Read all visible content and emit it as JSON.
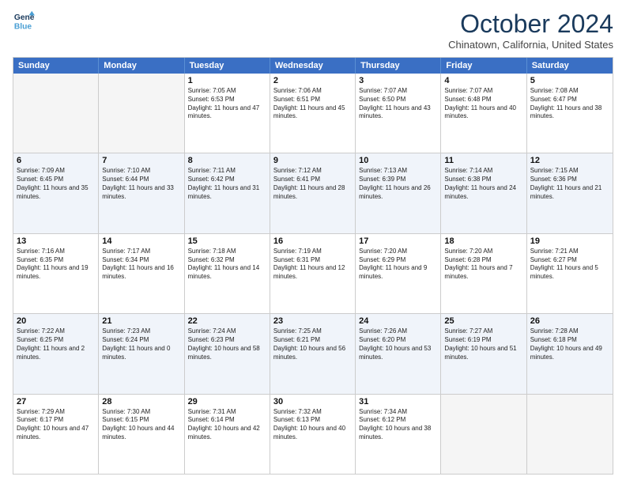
{
  "header": {
    "logo_line1": "General",
    "logo_line2": "Blue",
    "month": "October 2024",
    "location": "Chinatown, California, United States"
  },
  "days_of_week": [
    "Sunday",
    "Monday",
    "Tuesday",
    "Wednesday",
    "Thursday",
    "Friday",
    "Saturday"
  ],
  "weeks": [
    [
      {
        "day": "",
        "text": ""
      },
      {
        "day": "",
        "text": ""
      },
      {
        "day": "1",
        "text": "Sunrise: 7:05 AM\nSunset: 6:53 PM\nDaylight: 11 hours and 47 minutes."
      },
      {
        "day": "2",
        "text": "Sunrise: 7:06 AM\nSunset: 6:51 PM\nDaylight: 11 hours and 45 minutes."
      },
      {
        "day": "3",
        "text": "Sunrise: 7:07 AM\nSunset: 6:50 PM\nDaylight: 11 hours and 43 minutes."
      },
      {
        "day": "4",
        "text": "Sunrise: 7:07 AM\nSunset: 6:48 PM\nDaylight: 11 hours and 40 minutes."
      },
      {
        "day": "5",
        "text": "Sunrise: 7:08 AM\nSunset: 6:47 PM\nDaylight: 11 hours and 38 minutes."
      }
    ],
    [
      {
        "day": "6",
        "text": "Sunrise: 7:09 AM\nSunset: 6:45 PM\nDaylight: 11 hours and 35 minutes."
      },
      {
        "day": "7",
        "text": "Sunrise: 7:10 AM\nSunset: 6:44 PM\nDaylight: 11 hours and 33 minutes."
      },
      {
        "day": "8",
        "text": "Sunrise: 7:11 AM\nSunset: 6:42 PM\nDaylight: 11 hours and 31 minutes."
      },
      {
        "day": "9",
        "text": "Sunrise: 7:12 AM\nSunset: 6:41 PM\nDaylight: 11 hours and 28 minutes."
      },
      {
        "day": "10",
        "text": "Sunrise: 7:13 AM\nSunset: 6:39 PM\nDaylight: 11 hours and 26 minutes."
      },
      {
        "day": "11",
        "text": "Sunrise: 7:14 AM\nSunset: 6:38 PM\nDaylight: 11 hours and 24 minutes."
      },
      {
        "day": "12",
        "text": "Sunrise: 7:15 AM\nSunset: 6:36 PM\nDaylight: 11 hours and 21 minutes."
      }
    ],
    [
      {
        "day": "13",
        "text": "Sunrise: 7:16 AM\nSunset: 6:35 PM\nDaylight: 11 hours and 19 minutes."
      },
      {
        "day": "14",
        "text": "Sunrise: 7:17 AM\nSunset: 6:34 PM\nDaylight: 11 hours and 16 minutes."
      },
      {
        "day": "15",
        "text": "Sunrise: 7:18 AM\nSunset: 6:32 PM\nDaylight: 11 hours and 14 minutes."
      },
      {
        "day": "16",
        "text": "Sunrise: 7:19 AM\nSunset: 6:31 PM\nDaylight: 11 hours and 12 minutes."
      },
      {
        "day": "17",
        "text": "Sunrise: 7:20 AM\nSunset: 6:29 PM\nDaylight: 11 hours and 9 minutes."
      },
      {
        "day": "18",
        "text": "Sunrise: 7:20 AM\nSunset: 6:28 PM\nDaylight: 11 hours and 7 minutes."
      },
      {
        "day": "19",
        "text": "Sunrise: 7:21 AM\nSunset: 6:27 PM\nDaylight: 11 hours and 5 minutes."
      }
    ],
    [
      {
        "day": "20",
        "text": "Sunrise: 7:22 AM\nSunset: 6:25 PM\nDaylight: 11 hours and 2 minutes."
      },
      {
        "day": "21",
        "text": "Sunrise: 7:23 AM\nSunset: 6:24 PM\nDaylight: 11 hours and 0 minutes."
      },
      {
        "day": "22",
        "text": "Sunrise: 7:24 AM\nSunset: 6:23 PM\nDaylight: 10 hours and 58 minutes."
      },
      {
        "day": "23",
        "text": "Sunrise: 7:25 AM\nSunset: 6:21 PM\nDaylight: 10 hours and 56 minutes."
      },
      {
        "day": "24",
        "text": "Sunrise: 7:26 AM\nSunset: 6:20 PM\nDaylight: 10 hours and 53 minutes."
      },
      {
        "day": "25",
        "text": "Sunrise: 7:27 AM\nSunset: 6:19 PM\nDaylight: 10 hours and 51 minutes."
      },
      {
        "day": "26",
        "text": "Sunrise: 7:28 AM\nSunset: 6:18 PM\nDaylight: 10 hours and 49 minutes."
      }
    ],
    [
      {
        "day": "27",
        "text": "Sunrise: 7:29 AM\nSunset: 6:17 PM\nDaylight: 10 hours and 47 minutes."
      },
      {
        "day": "28",
        "text": "Sunrise: 7:30 AM\nSunset: 6:15 PM\nDaylight: 10 hours and 44 minutes."
      },
      {
        "day": "29",
        "text": "Sunrise: 7:31 AM\nSunset: 6:14 PM\nDaylight: 10 hours and 42 minutes."
      },
      {
        "day": "30",
        "text": "Sunrise: 7:32 AM\nSunset: 6:13 PM\nDaylight: 10 hours and 40 minutes."
      },
      {
        "day": "31",
        "text": "Sunrise: 7:34 AM\nSunset: 6:12 PM\nDaylight: 10 hours and 38 minutes."
      },
      {
        "day": "",
        "text": ""
      },
      {
        "day": "",
        "text": ""
      }
    ]
  ]
}
